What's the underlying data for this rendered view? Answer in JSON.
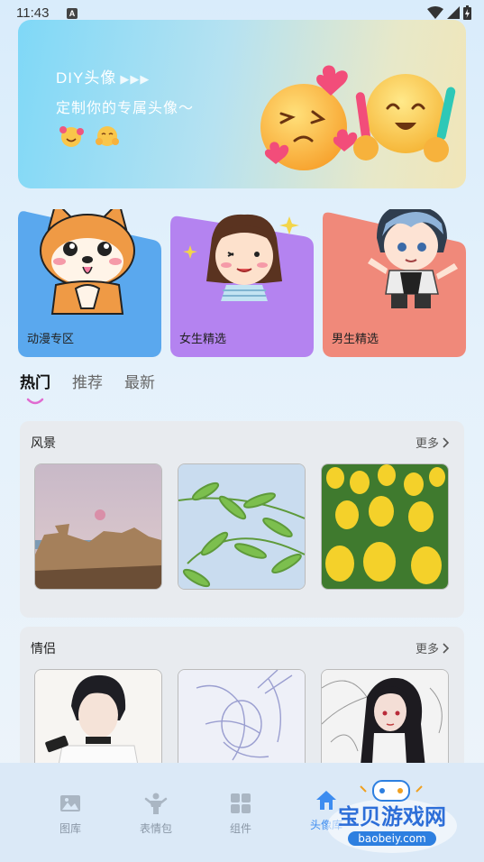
{
  "status_bar": {
    "time": "11:43",
    "a_badge": "A"
  },
  "banner": {
    "title": "DIY头像",
    "arrows": "▶▶▶",
    "subtitle": "定制你的专属头像～"
  },
  "categories": [
    {
      "label": "动漫专区",
      "color": "#5aa8ee"
    },
    {
      "label": "女生精选",
      "color": "#b483f0"
    },
    {
      "label": "男生精选",
      "color": "#f0897a"
    }
  ],
  "tabs": [
    "热门",
    "推荐",
    "最新"
  ],
  "sections": [
    {
      "title": "风景",
      "more": "更多"
    },
    {
      "title": "情侣",
      "more": "更多"
    }
  ],
  "nav": [
    {
      "label": "图库",
      "icon": "gallery-icon"
    },
    {
      "label": "表情包",
      "icon": "sticker-icon"
    },
    {
      "label": "组件",
      "icon": "widget-icon"
    },
    {
      "label": "头像库",
      "icon": "home-avatar-icon"
    }
  ],
  "watermark": {
    "text": "宝贝游戏网",
    "url": "baobeiy.com"
  },
  "colors": {
    "accent_active": "#3c8cf0",
    "tab_indicator": "#e06bd0"
  }
}
